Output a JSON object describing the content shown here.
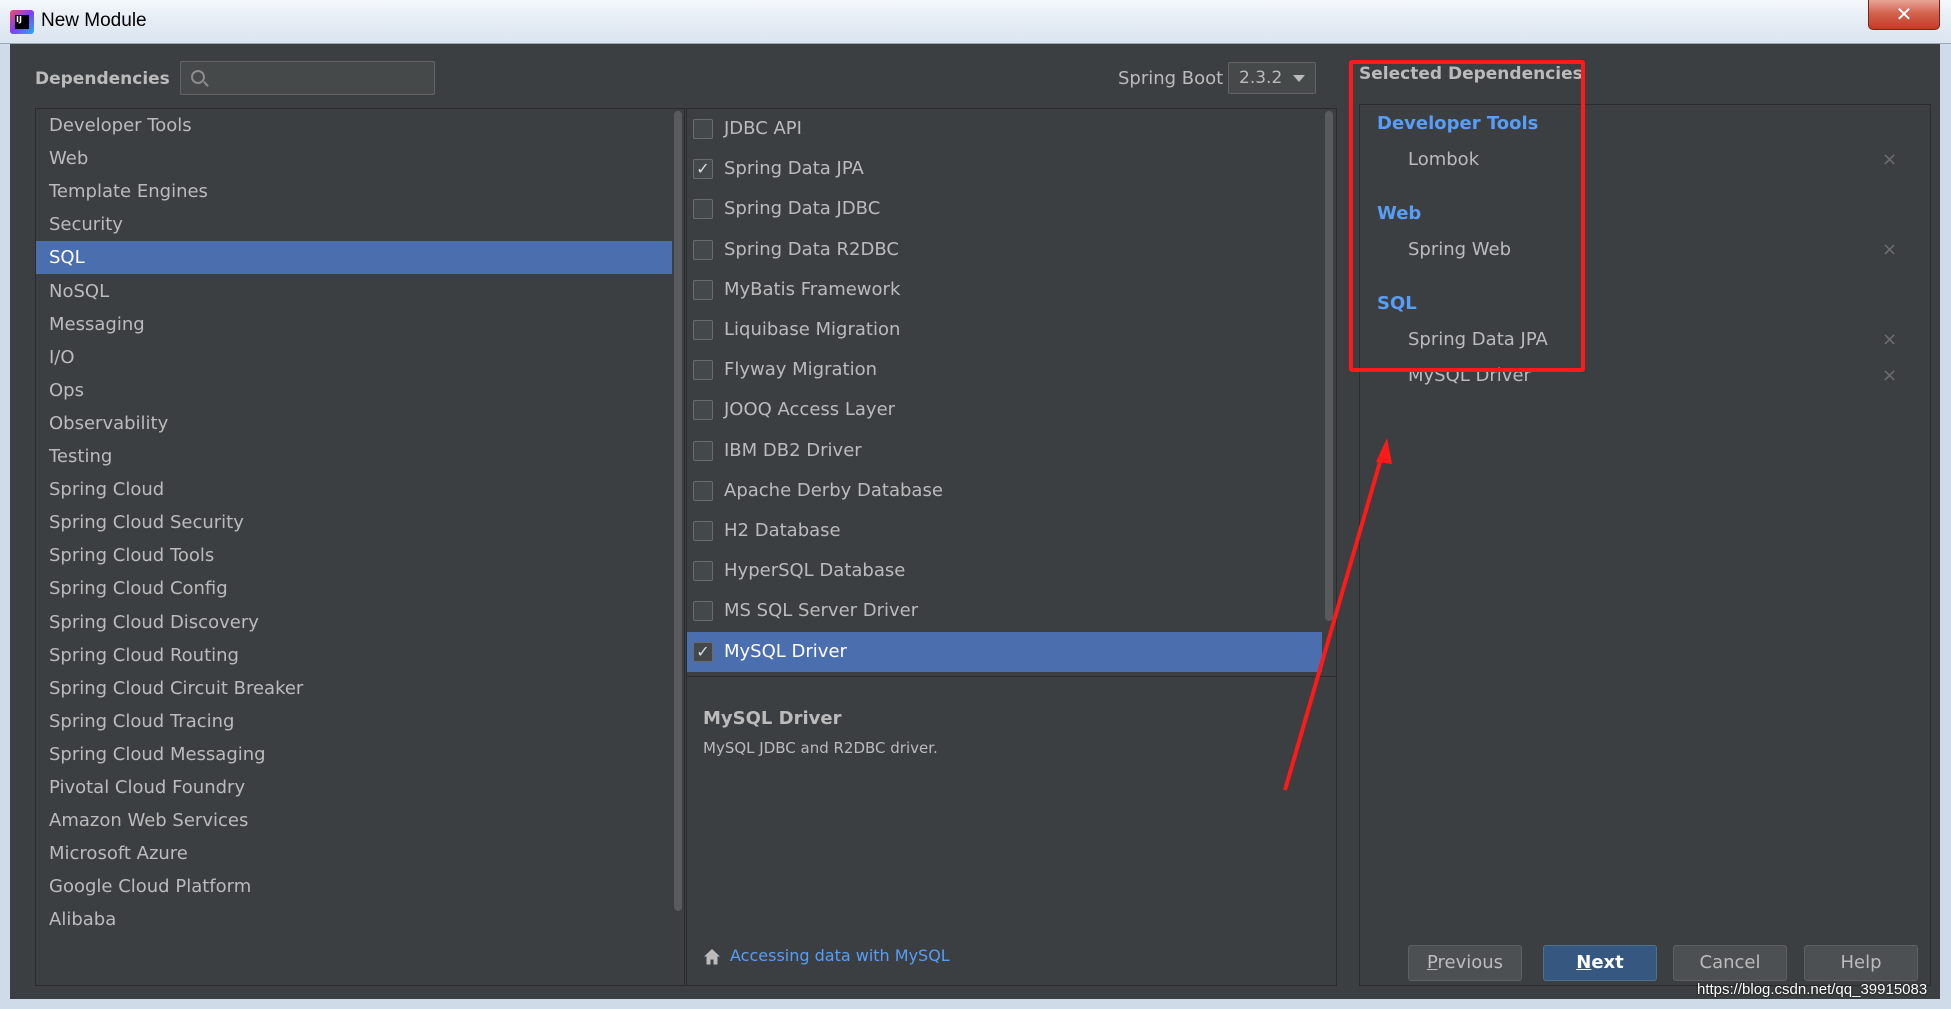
{
  "window": {
    "title": "New Module",
    "close_glyph": "✕"
  },
  "header": {
    "dependencies_label": "Dependencies",
    "search": {
      "value": "",
      "placeholder": ""
    },
    "spring_boot_label": "Spring Boot",
    "spring_boot_version": "2.3.2",
    "selected_title": "Selected Dependencies"
  },
  "categories": [
    "Developer Tools",
    "Web",
    "Template Engines",
    "Security",
    "SQL",
    "NoSQL",
    "Messaging",
    "I/O",
    "Ops",
    "Observability",
    "Testing",
    "Spring Cloud",
    "Spring Cloud Security",
    "Spring Cloud Tools",
    "Spring Cloud Config",
    "Spring Cloud Discovery",
    "Spring Cloud Routing",
    "Spring Cloud Circuit Breaker",
    "Spring Cloud Tracing",
    "Spring Cloud Messaging",
    "Pivotal Cloud Foundry",
    "Amazon Web Services",
    "Microsoft Azure",
    "Google Cloud Platform",
    "Alibaba"
  ],
  "selected_category": "SQL",
  "dependencies": [
    {
      "label": "JDBC API",
      "checked": false,
      "selected": false
    },
    {
      "label": "Spring Data JPA",
      "checked": true,
      "selected": false
    },
    {
      "label": "Spring Data JDBC",
      "checked": false,
      "selected": false
    },
    {
      "label": "Spring Data R2DBC",
      "checked": false,
      "selected": false
    },
    {
      "label": "MyBatis Framework",
      "checked": false,
      "selected": false
    },
    {
      "label": "Liquibase Migration",
      "checked": false,
      "selected": false
    },
    {
      "label": "Flyway Migration",
      "checked": false,
      "selected": false
    },
    {
      "label": "JOOQ Access Layer",
      "checked": false,
      "selected": false
    },
    {
      "label": "IBM DB2 Driver",
      "checked": false,
      "selected": false
    },
    {
      "label": "Apache Derby Database",
      "checked": false,
      "selected": false
    },
    {
      "label": "H2 Database",
      "checked": false,
      "selected": false
    },
    {
      "label": "HyperSQL Database",
      "checked": false,
      "selected": false
    },
    {
      "label": "MS SQL Server Driver",
      "checked": false,
      "selected": false
    },
    {
      "label": "MySQL Driver",
      "checked": true,
      "selected": true
    }
  ],
  "check_glyph": "✓",
  "description": {
    "title": "MySQL Driver",
    "text": "MySQL JDBC and R2DBC driver.",
    "guide_link": "Accessing data with MySQL"
  },
  "selected_groups": [
    {
      "title": "Developer Tools",
      "items": [
        "Lombok"
      ]
    },
    {
      "title": "Web",
      "items": [
        "Spring Web"
      ]
    },
    {
      "title": "SQL",
      "items": [
        "Spring Data JPA",
        "MySQL Driver"
      ]
    }
  ],
  "remove_glyph": "×",
  "buttons": {
    "previous": {
      "mnemonic": "P",
      "rest": "revious"
    },
    "next": {
      "mnemonic": "N",
      "rest": "ext"
    },
    "cancel": "Cancel",
    "help": "Help"
  },
  "watermark": "https://blog.csdn.net/qq_39915083",
  "colors": {
    "dialog_bg": "#3c3f41",
    "selection": "#4b6eaf",
    "group_title": "#589df6",
    "annotation_red": "#ff1a1a",
    "primary_button": "#365880"
  }
}
